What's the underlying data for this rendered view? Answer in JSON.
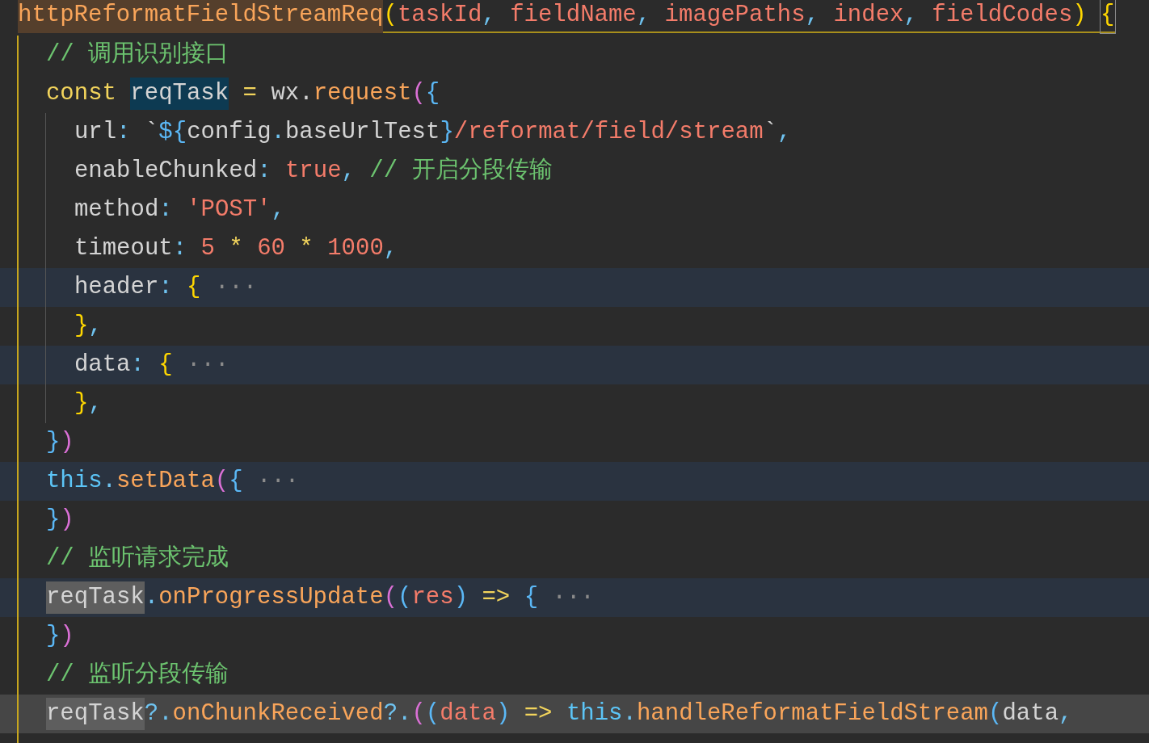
{
  "editor": {
    "lines": [
      {
        "folded": false,
        "current": false,
        "bracket_match": true,
        "tokens": [
          {
            "text": "httpReformatFieldStreamReq",
            "kind": "func",
            "selected": false,
            "marked": true
          },
          {
            "text": "(",
            "kind": "bracket1",
            "selected": false,
            "marked": false
          },
          {
            "text": "taskId",
            "kind": "param",
            "selected": false,
            "marked": false
          },
          {
            "text": ", ",
            "kind": "punct",
            "selected": false,
            "marked": false
          },
          {
            "text": "fieldName",
            "kind": "param",
            "selected": false,
            "marked": false
          },
          {
            "text": ", ",
            "kind": "punct",
            "selected": false,
            "marked": false
          },
          {
            "text": "imagePaths",
            "kind": "param",
            "selected": false,
            "marked": false
          },
          {
            "text": ", ",
            "kind": "punct",
            "selected": false,
            "marked": false
          },
          {
            "text": "index",
            "kind": "param",
            "selected": false,
            "marked": false
          },
          {
            "text": ", ",
            "kind": "punct",
            "selected": false,
            "marked": false
          },
          {
            "text": "fieldCodes",
            "kind": "param",
            "selected": false,
            "marked": false
          },
          {
            "text": ") ",
            "kind": "bracket1",
            "selected": false,
            "marked": false
          },
          {
            "text": "{",
            "kind": "bracket1",
            "selected": false,
            "marked": false
          }
        ],
        "children": [
          {
            "folded": false,
            "current": false,
            "bracket_match": false,
            "tokens": [
              {
                "text": "// 调用识别接口",
                "kind": "comment",
                "selected": false,
                "marked": false
              }
            ]
          },
          {
            "folded": false,
            "current": false,
            "bracket_match": false,
            "tokens": [
              {
                "text": "const ",
                "kind": "keyword",
                "selected": false,
                "marked": false
              },
              {
                "text": "reqTask",
                "kind": "plain",
                "selected": true,
                "marked": false
              },
              {
                "text": " = ",
                "kind": "keyword",
                "selected": false,
                "marked": false
              },
              {
                "text": "wx.",
                "kind": "plain",
                "selected": false,
                "marked": false
              },
              {
                "text": "request",
                "kind": "func",
                "selected": false,
                "marked": false
              },
              {
                "text": "(",
                "kind": "bracket2",
                "selected": false,
                "marked": false
              },
              {
                "text": "{",
                "kind": "bracket3",
                "selected": false,
                "marked": false
              }
            ],
            "children": [
              {
                "folded": false,
                "current": false,
                "bracket_match": false,
                "tokens": [
                  {
                    "text": "url",
                    "kind": "plain",
                    "selected": false,
                    "marked": false
                  },
                  {
                    "text": ": ",
                    "kind": "punct",
                    "selected": false,
                    "marked": false
                  },
                  {
                    "text": "`",
                    "kind": "plain",
                    "selected": false,
                    "marked": false
                  },
                  {
                    "text": "${",
                    "kind": "bracket3",
                    "selected": false,
                    "marked": false
                  },
                  {
                    "text": "config",
                    "kind": "plain",
                    "selected": false,
                    "marked": false
                  },
                  {
                    "text": ".",
                    "kind": "punct",
                    "selected": false,
                    "marked": false
                  },
                  {
                    "text": "baseUrlTest",
                    "kind": "plain",
                    "selected": false,
                    "marked": false
                  },
                  {
                    "text": "}",
                    "kind": "bracket3",
                    "selected": false,
                    "marked": false
                  },
                  {
                    "text": "/reformat/field/stream",
                    "kind": "string",
                    "selected": false,
                    "marked": false
                  },
                  {
                    "text": "`",
                    "kind": "plain",
                    "selected": false,
                    "marked": false
                  },
                  {
                    "text": ",",
                    "kind": "punct",
                    "selected": false,
                    "marked": false
                  }
                ]
              },
              {
                "folded": false,
                "current": false,
                "bracket_match": false,
                "tokens": [
                  {
                    "text": "enableChunked",
                    "kind": "plain",
                    "selected": false,
                    "marked": false
                  },
                  {
                    "text": ": ",
                    "kind": "punct",
                    "selected": false,
                    "marked": false
                  },
                  {
                    "text": "true",
                    "kind": "string",
                    "selected": false,
                    "marked": false
                  },
                  {
                    "text": ",",
                    "kind": "punct",
                    "selected": false,
                    "marked": false
                  },
                  {
                    "text": " // 开启分段传输",
                    "kind": "comment",
                    "selected": false,
                    "marked": false
                  }
                ]
              },
              {
                "folded": false,
                "current": false,
                "bracket_match": false,
                "tokens": [
                  {
                    "text": "method",
                    "kind": "plain",
                    "selected": false,
                    "marked": false
                  },
                  {
                    "text": ": ",
                    "kind": "punct",
                    "selected": false,
                    "marked": false
                  },
                  {
                    "text": "'POST'",
                    "kind": "string",
                    "selected": false,
                    "marked": false
                  },
                  {
                    "text": ",",
                    "kind": "punct",
                    "selected": false,
                    "marked": false
                  }
                ]
              },
              {
                "folded": false,
                "current": false,
                "bracket_match": false,
                "tokens": [
                  {
                    "text": "timeout",
                    "kind": "plain",
                    "selected": false,
                    "marked": false
                  },
                  {
                    "text": ": ",
                    "kind": "punct",
                    "selected": false,
                    "marked": false
                  },
                  {
                    "text": "5",
                    "kind": "string",
                    "selected": false,
                    "marked": false
                  },
                  {
                    "text": " * ",
                    "kind": "keyword",
                    "selected": false,
                    "marked": false
                  },
                  {
                    "text": "60",
                    "kind": "string",
                    "selected": false,
                    "marked": false
                  },
                  {
                    "text": " * ",
                    "kind": "keyword",
                    "selected": false,
                    "marked": false
                  },
                  {
                    "text": "1000",
                    "kind": "string",
                    "selected": false,
                    "marked": false
                  },
                  {
                    "text": ",",
                    "kind": "punct",
                    "selected": false,
                    "marked": false
                  }
                ]
              },
              {
                "folded": true,
                "current": false,
                "bracket_match": false,
                "tokens": [
                  {
                    "text": "header",
                    "kind": "plain",
                    "selected": false,
                    "marked": false
                  },
                  {
                    "text": ": ",
                    "kind": "punct",
                    "selected": false,
                    "marked": false
                  },
                  {
                    "text": "{",
                    "kind": "bracket1",
                    "selected": false,
                    "marked": false
                  },
                  {
                    "text": " ···",
                    "kind": "fold",
                    "selected": false,
                    "marked": false
                  }
                ]
              },
              {
                "folded": false,
                "current": false,
                "bracket_match": false,
                "tokens": [
                  {
                    "text": "}",
                    "kind": "bracket1",
                    "selected": false,
                    "marked": false
                  },
                  {
                    "text": ",",
                    "kind": "punct",
                    "selected": false,
                    "marked": false
                  }
                ]
              },
              {
                "folded": true,
                "current": false,
                "bracket_match": false,
                "tokens": [
                  {
                    "text": "data",
                    "kind": "plain",
                    "selected": false,
                    "marked": false
                  },
                  {
                    "text": ": ",
                    "kind": "punct",
                    "selected": false,
                    "marked": false
                  },
                  {
                    "text": "{",
                    "kind": "bracket1",
                    "selected": false,
                    "marked": false
                  },
                  {
                    "text": " ···",
                    "kind": "fold",
                    "selected": false,
                    "marked": false
                  }
                ]
              },
              {
                "folded": false,
                "current": false,
                "bracket_match": false,
                "tokens": [
                  {
                    "text": "}",
                    "kind": "bracket1",
                    "selected": false,
                    "marked": false
                  },
                  {
                    "text": ",",
                    "kind": "punct",
                    "selected": false,
                    "marked": false
                  }
                ]
              }
            ]
          },
          {
            "folded": false,
            "current": false,
            "bracket_match": false,
            "tokens": [
              {
                "text": "}",
                "kind": "bracket3",
                "selected": false,
                "marked": false
              },
              {
                "text": ")",
                "kind": "bracket2",
                "selected": false,
                "marked": false
              }
            ]
          },
          {
            "folded": true,
            "current": false,
            "bracket_match": false,
            "tokens": [
              {
                "text": "this",
                "kind": "this",
                "selected": false,
                "marked": false
              },
              {
                "text": ".",
                "kind": "punct",
                "selected": false,
                "marked": false
              },
              {
                "text": "setData",
                "kind": "func",
                "selected": false,
                "marked": false
              },
              {
                "text": "(",
                "kind": "bracket2",
                "selected": false,
                "marked": false
              },
              {
                "text": "{",
                "kind": "bracket3",
                "selected": false,
                "marked": false
              },
              {
                "text": " ···",
                "kind": "fold",
                "selected": false,
                "marked": false
              }
            ]
          },
          {
            "folded": false,
            "current": false,
            "bracket_match": false,
            "tokens": [
              {
                "text": "}",
                "kind": "bracket3",
                "selected": false,
                "marked": false
              },
              {
                "text": ")",
                "kind": "bracket2",
                "selected": false,
                "marked": false
              }
            ]
          },
          {
            "folded": false,
            "current": false,
            "bracket_match": false,
            "tokens": [
              {
                "text": "// 监听请求完成",
                "kind": "comment",
                "selected": false,
                "marked": false
              }
            ]
          },
          {
            "folded": true,
            "current": false,
            "bracket_match": false,
            "tokens": [
              {
                "text": "reqTask",
                "kind": "plain",
                "selected": false,
                "marked": true
              },
              {
                "text": ".",
                "kind": "punct",
                "selected": false,
                "marked": false
              },
              {
                "text": "onProgressUpdate",
                "kind": "func",
                "selected": false,
                "marked": false
              },
              {
                "text": "(",
                "kind": "bracket2",
                "selected": false,
                "marked": false
              },
              {
                "text": "(",
                "kind": "bracket3",
                "selected": false,
                "marked": false
              },
              {
                "text": "res",
                "kind": "param",
                "selected": false,
                "marked": false
              },
              {
                "text": ")",
                "kind": "bracket3",
                "selected": false,
                "marked": false
              },
              {
                "text": " => ",
                "kind": "keyword",
                "selected": false,
                "marked": false
              },
              {
                "text": "{",
                "kind": "bracket3",
                "selected": false,
                "marked": false
              },
              {
                "text": " ···",
                "kind": "fold",
                "selected": false,
                "marked": false
              }
            ]
          },
          {
            "folded": false,
            "current": false,
            "bracket_match": false,
            "tokens": [
              {
                "text": "}",
                "kind": "bracket3",
                "selected": false,
                "marked": false
              },
              {
                "text": ")",
                "kind": "bracket2",
                "selected": false,
                "marked": false
              }
            ]
          },
          {
            "folded": false,
            "current": false,
            "bracket_match": false,
            "tokens": [
              {
                "text": "// 监听分段传输",
                "kind": "comment",
                "selected": false,
                "marked": false
              }
            ]
          },
          {
            "folded": false,
            "current": true,
            "bracket_match": false,
            "tokens": [
              {
                "text": "reqTask",
                "kind": "plain",
                "selected": false,
                "marked": true
              },
              {
                "text": "?.",
                "kind": "punct",
                "selected": false,
                "marked": false
              },
              {
                "text": "onChunkReceived",
                "kind": "func",
                "selected": false,
                "marked": false
              },
              {
                "text": "?.",
                "kind": "punct",
                "selected": false,
                "marked": false
              },
              {
                "text": "(",
                "kind": "bracket2",
                "selected": false,
                "marked": false
              },
              {
                "text": "(",
                "kind": "bracket3",
                "selected": false,
                "marked": false
              },
              {
                "text": "data",
                "kind": "param",
                "selected": false,
                "marked": false
              },
              {
                "text": ")",
                "kind": "bracket3",
                "selected": false,
                "marked": false
              },
              {
                "text": " => ",
                "kind": "keyword",
                "selected": false,
                "marked": false
              },
              {
                "text": "this",
                "kind": "this",
                "selected": false,
                "marked": false
              },
              {
                "text": ".",
                "kind": "punct",
                "selected": false,
                "marked": false
              },
              {
                "text": "handleReformatFieldStream",
                "kind": "func",
                "selected": false,
                "marked": false
              },
              {
                "text": "(",
                "kind": "bracket3",
                "selected": false,
                "marked": false
              },
              {
                "text": "data",
                "kind": "plain",
                "selected": false,
                "marked": false
              },
              {
                "text": ",",
                "kind": "punct",
                "selected": false,
                "marked": false
              }
            ]
          }
        ]
      }
    ]
  }
}
